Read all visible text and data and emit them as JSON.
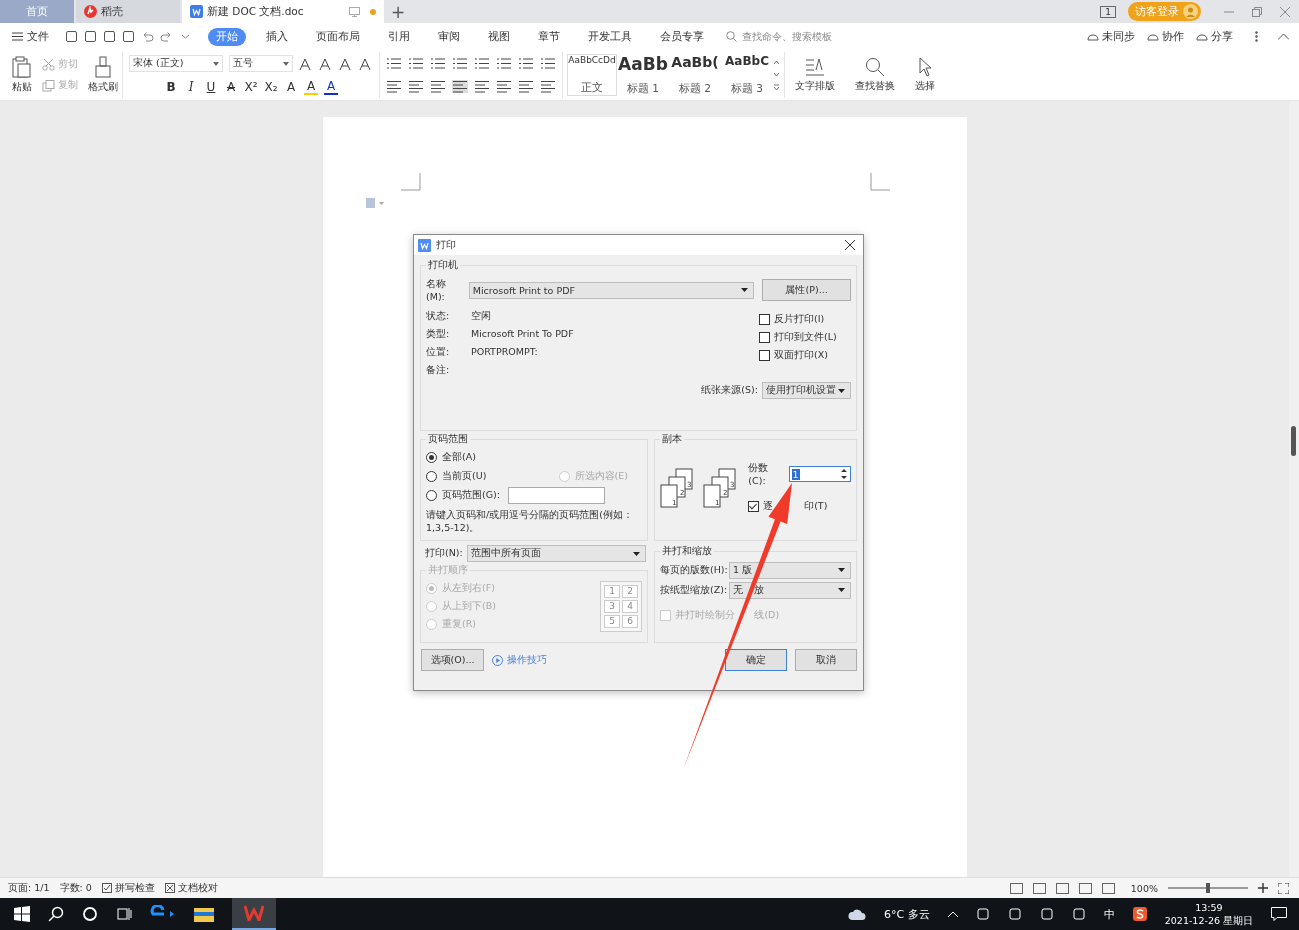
{
  "tabs": [
    {
      "label": "首页",
      "kind": "home",
      "selected": false
    },
    {
      "label": "稻壳",
      "kind": "store",
      "selected": false
    },
    {
      "label": "新建 DOC 文档.doc",
      "kind": "doc",
      "selected": true
    }
  ],
  "new_tab": "+",
  "window_count": "1",
  "account": "访客登录",
  "menu": {
    "file": "文件",
    "items": [
      {
        "label": "开始",
        "selected": true
      },
      {
        "label": "插入",
        "selected": false
      },
      {
        "label": "页面布局",
        "selected": false
      },
      {
        "label": "引用",
        "selected": false
      },
      {
        "label": "审阅",
        "selected": false
      },
      {
        "label": "视图",
        "selected": false
      },
      {
        "label": "章节",
        "selected": false
      },
      {
        "label": "开发工具",
        "selected": false
      },
      {
        "label": "会员专享",
        "selected": false
      }
    ],
    "search": {
      "placeholder": "查找命令、搜索模板"
    },
    "actions": [
      "未同步",
      "协作",
      "分享"
    ]
  },
  "ribbon": {
    "paste": "粘贴",
    "cut": "剪切",
    "copy": "复制",
    "format_painter": "格式刷",
    "font": "宋体 (正文)",
    "size": "五号",
    "glyphs": [
      "B",
      "I",
      "U",
      "A",
      "X²",
      "X₂",
      "A",
      "A",
      "A"
    ],
    "styles": [
      {
        "preview": "AaBbCcDd",
        "label": "正文"
      },
      {
        "preview": "AaBb",
        "label": "标题 1"
      },
      {
        "preview": "AaBb(",
        "label": "标题 2"
      },
      {
        "preview": "AaBbC",
        "label": "标题 3"
      }
    ],
    "tools": [
      "文字排版",
      "查找替换",
      "选择"
    ]
  },
  "dialog": {
    "title": "打印",
    "printer": {
      "legend": "打印机",
      "name_label": "名称(M):",
      "name": "Microsoft Print to PDF",
      "properties": "属性(P)...",
      "info": [
        {
          "label": "状态:",
          "value": "空闲"
        },
        {
          "label": "类型:",
          "value": "Microsoft Print To PDF"
        },
        {
          "label": "位置:",
          "value": "PORTPROMPT:"
        },
        {
          "label": "备注:"
        }
      ],
      "options": [
        {
          "label": "反片打印(I)",
          "checked": false
        },
        {
          "label": "打印到文件(L)",
          "checked": false
        },
        {
          "label": "双面打印(X)",
          "checked": false
        }
      ],
      "source_label": "纸张来源(S):",
      "source": "使用打印机设置"
    },
    "range": {
      "legend": "页码范围",
      "radios": [
        {
          "label": "全部(A)",
          "selected": true
        },
        {
          "label": "当前页(U)",
          "selected": false
        },
        {
          "label": "页码范围(G):",
          "selected": false
        }
      ],
      "selection": {
        "label": "所选内容(E)",
        "selected": false,
        "disabled": true
      },
      "hint": "请键入页码和/或用逗号分隔的页码范围(例如：1,3,5-12)。"
    },
    "copies": {
      "legend": "副本",
      "label": "份数(C):",
      "value": "1",
      "stacks": [
        [
          "1",
          "2",
          "3"
        ],
        [
          "1",
          "2",
          "3"
        ]
      ],
      "collate": {
        "label": [
          "逐",
          "印(T)"
        ],
        "checked": true
      }
    },
    "print_label": "打印(N):",
    "print_value": "范围中所有页面",
    "order": {
      "legend": "并打顺序",
      "disabled": true,
      "radios": [
        {
          "label": "从左到右(F)",
          "selected": true
        },
        {
          "label": "从上到下(B)",
          "selected": false
        },
        {
          "label": "重复(R)",
          "selected": false
        }
      ],
      "grid": [
        "1",
        "2",
        "3",
        "4",
        "5",
        "6"
      ]
    },
    "zoom": {
      "legend": "并打和缩放",
      "pages_label": "每页的版数(H):",
      "pages": "1 版",
      "scale_label": "按纸型缩放(Z):",
      "scale": [
        "无",
        "放"
      ],
      "lines": {
        "label": [
          "并打时绘制分",
          "线(D)"
        ],
        "checked": false,
        "disabled": true
      }
    },
    "buttons": {
      "options": "选项(O)...",
      "tips": "操作技巧",
      "ok": "确定",
      "cancel": "取消"
    }
  },
  "status_bar": {
    "page": "页面: 1/1",
    "words": "字数: 0",
    "spell": "拼写检查",
    "proof": "文档校对",
    "zoom": "100%",
    "zoom_slider": {
      "level": 0.5
    }
  },
  "taskbar": {
    "weather": "6°C 多云",
    "ime": "中",
    "time": "13:59",
    "date": "2021-12-26 星期日"
  }
}
